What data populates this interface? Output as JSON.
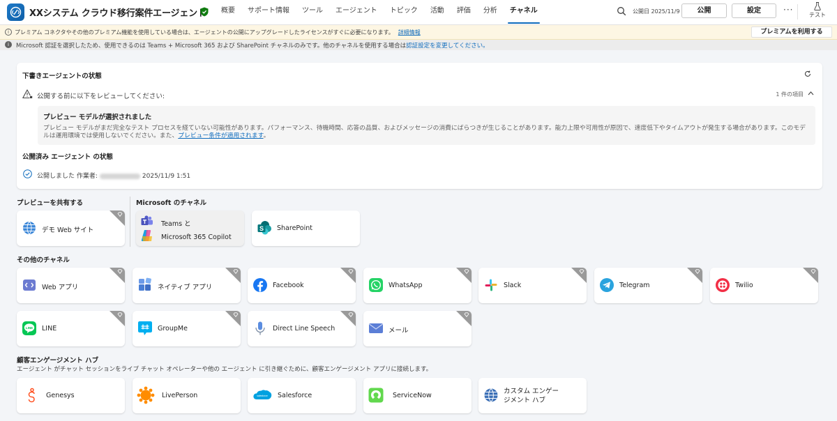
{
  "header": {
    "agent_name": "XXシステム クラウド移行案件エージェント",
    "tabs": [
      "概要",
      "サポート情報",
      "ツール",
      "エージェント",
      "トピック",
      "活動",
      "評価",
      "分析",
      "チャネル"
    ],
    "active_tab": "チャネル",
    "publish_date": "公開日 2025/11/9",
    "publish_button": "公開",
    "settings_button": "設定",
    "more_label": "···",
    "test_label": "テスト"
  },
  "banner_premium": {
    "message": "プレミアム コネクタやその他のプレミアム機能を使用している場合は、エージェントの公開にアップグレードしたライセンスがすぐに必要になります。",
    "link": "詳細情報",
    "button": "プレミアムを利用する"
  },
  "banner_auth": {
    "message": "Microsoft 認証を選択したため、使用できるのは Teams + Microsoft 365 および SharePoint チャネルのみです。他のチャネルを使用する場合は",
    "link": "認証設定を変更してください。"
  },
  "draft_status": {
    "title": "下書きエージェントの状態",
    "review_label": "公開する前に以下をレビューしてください:",
    "item_count": "1 件の項目",
    "preview_title": "プレビュー モデルが選択されました",
    "preview_text": "プレビュー モデルがまだ完全なテスト プロセスを経ていない可能性があります。パフォーマンス、待機時間、応答の品質、およびメッセージの消費にばらつきが生じることがあります。能力上限や可用性が原因で、速度低下やタイムアウトが発生する場合があります。このモデルは運用環境では使用しないでください。また、",
    "preview_link": "プレビュー条件が適用されます",
    "preview_end": "。"
  },
  "published_status": {
    "title": "公開済み エージェント の状態",
    "prefix": "公開しました 作業者:",
    "datetime": "2025/11/9 1:51"
  },
  "sections": {
    "share_preview": "プレビューを共有する",
    "microsoft_channels": "Microsoft のチャネル",
    "other_channels": "その他のチャネル",
    "engagement_hub": "顧客エンゲージメント ハブ",
    "engagement_desc": "エージェント がチャット セッションをライブ チャット オペレーターや他の エージェント に引き継ぐために、顧客エンゲージメント アプリに接続します。"
  },
  "tiles": {
    "demo_web": "デモ Web サイト",
    "teams_line1": "Teams と",
    "teams_line2": "Microsoft 365 Copilot",
    "sharepoint": "SharePoint",
    "web_app": "Web アプリ",
    "native_app": "ネイティブ アプリ",
    "facebook": "Facebook",
    "whatsapp": "WhatsApp",
    "slack": "Slack",
    "telegram": "Telegram",
    "twilio": "Twilio",
    "line": "LINE",
    "groupme": "GroupMe",
    "direct_line_speech": "Direct Line Speech",
    "email": "メール",
    "genesys": "Genesys",
    "liveperson": "LivePerson",
    "salesforce": "Salesforce",
    "servicenow": "ServiceNow",
    "custom_line1": "カスタム エンゲー",
    "custom_line2": "ジメント ハブ",
    "salesforce_logo_text": "salesforce"
  },
  "colors": {
    "accent": "#0f6cbd",
    "premium_corner": "#9a9a9a",
    "banner_yellow": "#fdf6e3"
  }
}
